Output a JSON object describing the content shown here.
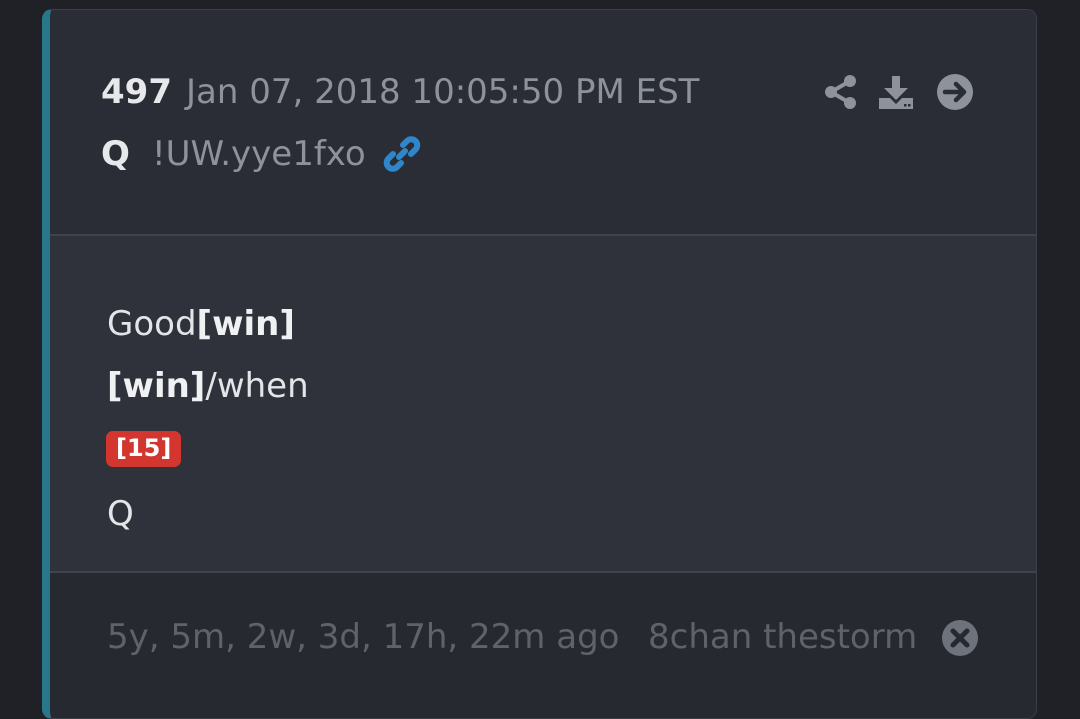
{
  "post": {
    "number": "497",
    "date": "Jan 07, 2018 10:05:50 PM EST",
    "author": "Q",
    "tripcode": "!UW.yye1fxo"
  },
  "icons": {
    "link": "link-icon",
    "share": "share-icon",
    "download": "download-icon",
    "next": "arrow-right-circle-icon",
    "close": "close-circle-icon"
  },
  "body": {
    "line1_text": "Good",
    "line1_bold": "[win]",
    "line2_bold": "[win]",
    "line2_text": "/when",
    "badge": "[15]",
    "signature": "Q"
  },
  "footer": {
    "ago": "5y, 5m, 2w, 3d, 17h, 22m ago",
    "source": "8chan thestorm"
  },
  "colors": {
    "accent_bar": "#27788a",
    "link_blue": "#2f87c9",
    "badge_red": "#d2362f",
    "icon_gray": "#8e929b"
  }
}
